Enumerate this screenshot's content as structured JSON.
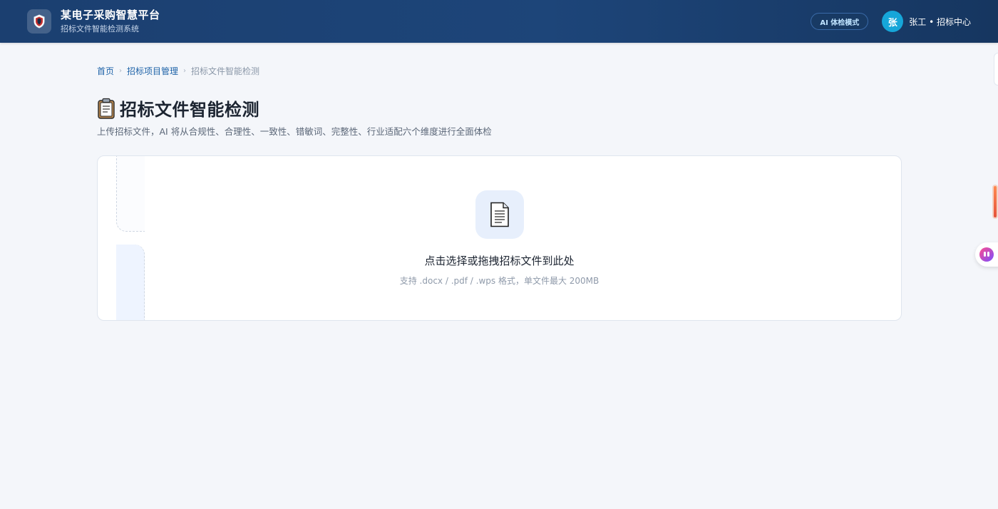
{
  "header": {
    "title": "某电子采购智慧平台",
    "subtitle": "招标文件智能检测系统",
    "logo_icon": "shield-icon",
    "ai_mode_label": "AI 体检模式",
    "avatar_char": "张",
    "user_label": "张工 • 招标中心"
  },
  "breadcrumb": {
    "home": "首页",
    "parent": "招标项目管理",
    "current": "招标文件智能检测"
  },
  "page": {
    "title_icon": "clipboard-icon",
    "title": "招标文件智能检测",
    "description": "上传招标文件，AI 将从合规性、合理性、一致性、错敏词、完整性、行业适配六个维度进行全面体检"
  },
  "upload": {
    "icon": "document-icon",
    "main_text": "点击选择或拖拽招标文件到此处",
    "hint": "支持 .docx / .pdf / .wps 格式，单文件最大 200MB"
  },
  "colors": {
    "header_bg": "#1d4579",
    "accent": "#1e63a8",
    "avatar_bg": "#16a6d9",
    "page_bg": "#f4f6fa"
  }
}
